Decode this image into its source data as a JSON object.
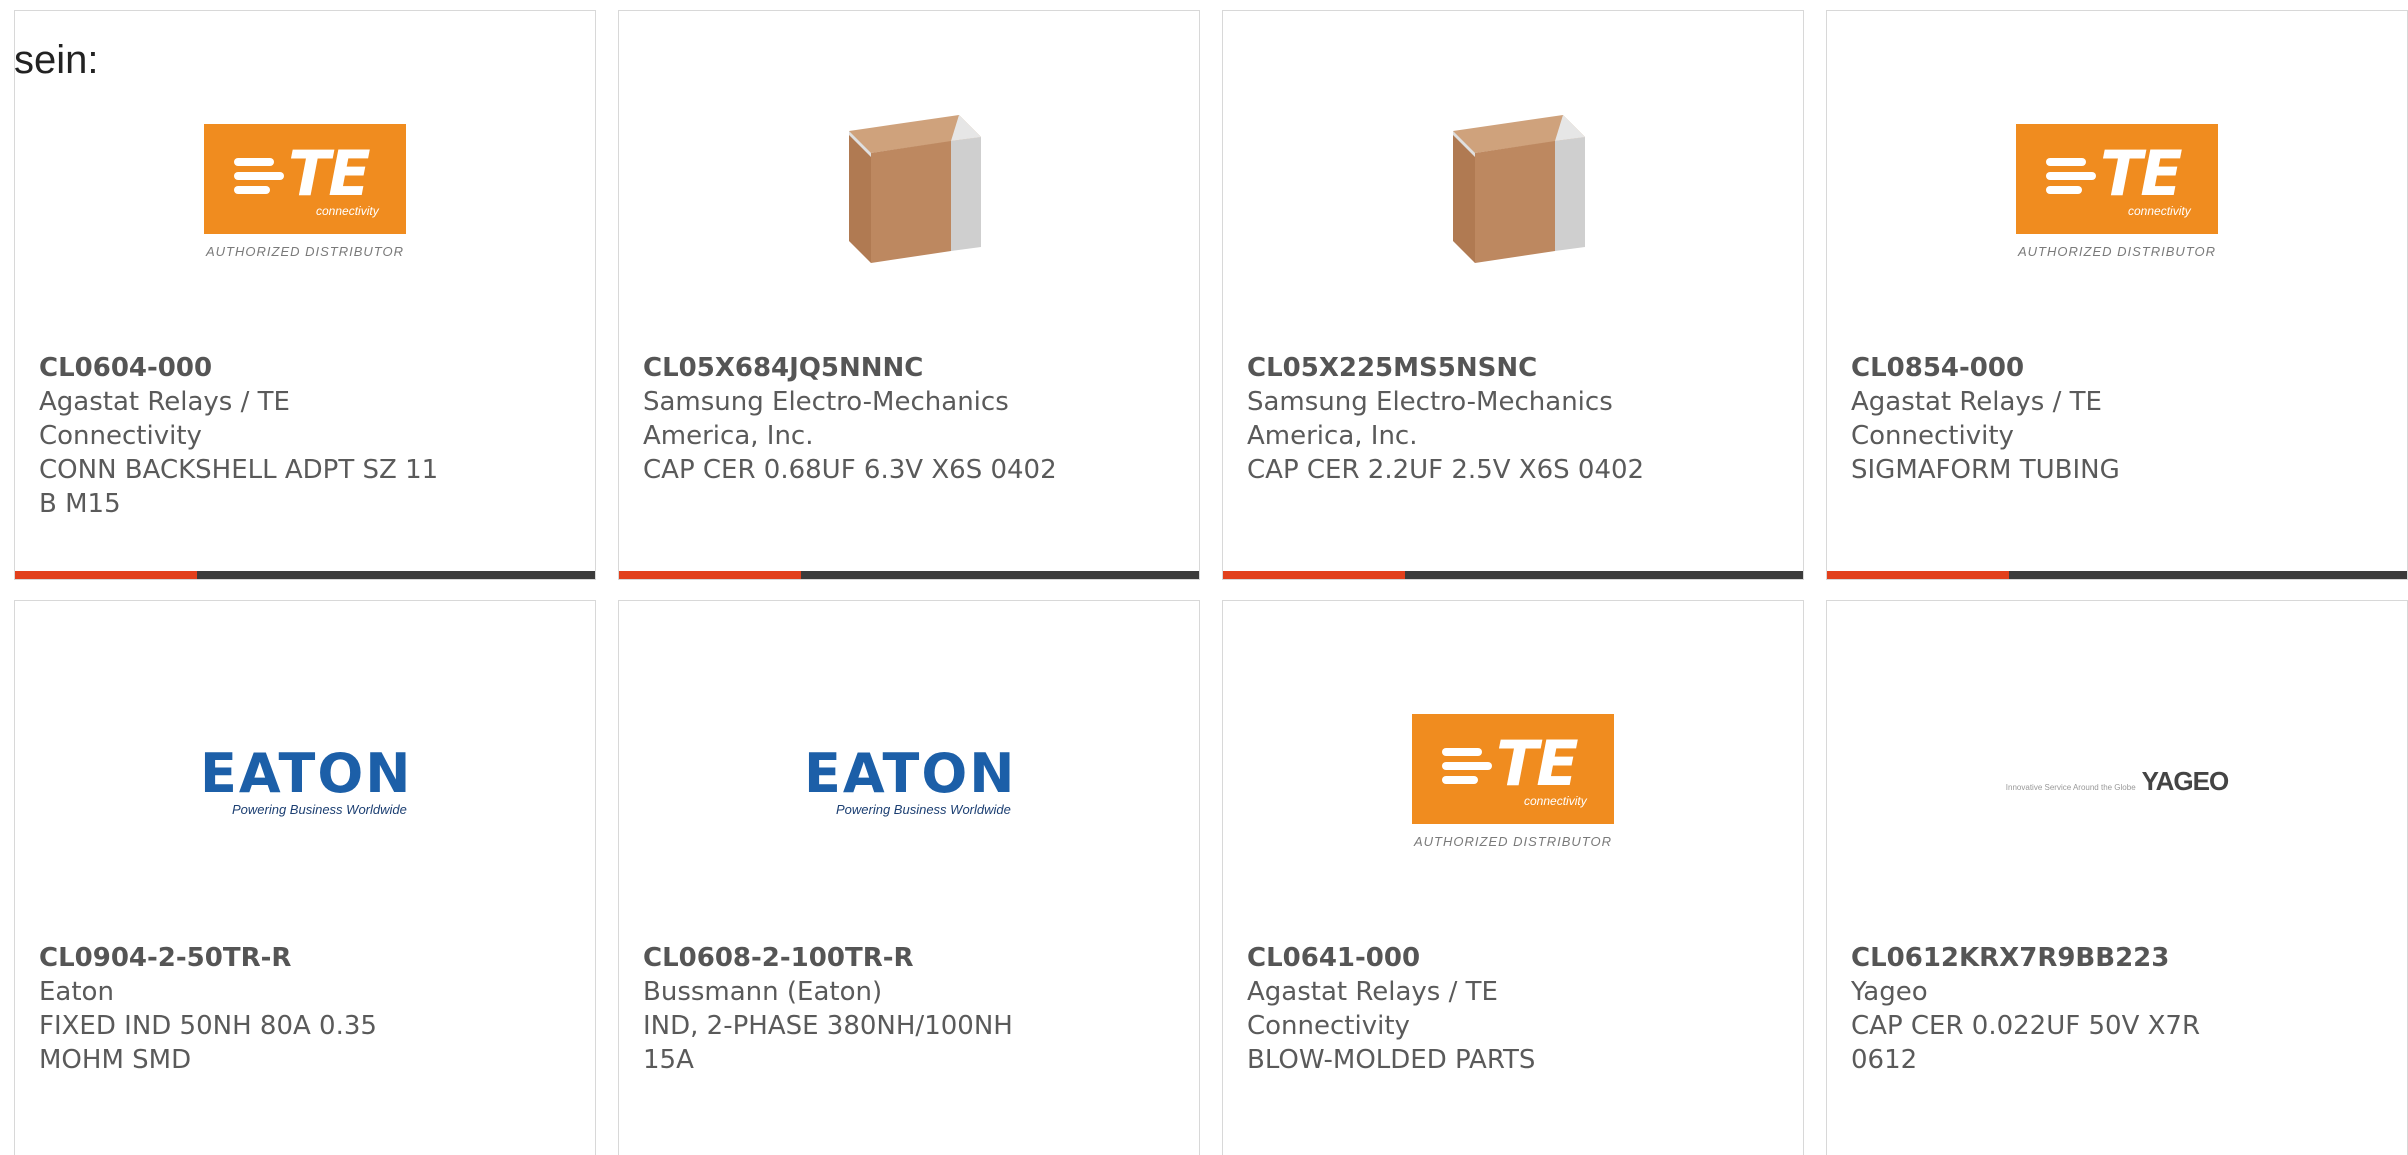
{
  "lead_text": "sein:",
  "accent_colors": {
    "bar_accent": "#e2401c",
    "bar_base": "#3b3b3b",
    "te_orange": "#f08c1f",
    "eaton_blue": "#1c5fa8"
  },
  "logos": {
    "te": {
      "letters": "TE",
      "sub": "connectivity",
      "tag": "AUTHORIZED DISTRIBUTOR"
    },
    "eaton": {
      "word": "EATON",
      "tag": "Powering Business Worldwide"
    },
    "yageo": {
      "small": "Innovative Service Around the Globe",
      "word": "YAGEO"
    }
  },
  "products": [
    {
      "image": "te-logo",
      "part": "CL0604-000",
      "manufacturer": "Agastat Relays / TE Connectivity",
      "description": "CONN BACKSHELL ADPT SZ 11 B M15"
    },
    {
      "image": "capacitor-chip",
      "part": "CL05X684JQ5NNNC",
      "manufacturer": "Samsung Electro-Mechanics America, Inc.",
      "description": "CAP CER 0.68UF 6.3V X6S 0402"
    },
    {
      "image": "capacitor-chip",
      "part": "CL05X225MS5NSNC",
      "manufacturer": "Samsung Electro-Mechanics America, Inc.",
      "description": "CAP CER 2.2UF 2.5V X6S 0402"
    },
    {
      "image": "te-logo",
      "part": "CL0854-000",
      "manufacturer": "Agastat Relays / TE Connectivity",
      "description": "SIGMAFORM TUBING"
    },
    {
      "image": "eaton-logo",
      "part": "CL0904-2-50TR-R",
      "manufacturer": "Eaton",
      "description": "FIXED IND 50NH 80A 0.35 MOHM SMD"
    },
    {
      "image": "eaton-logo",
      "part": "CL0608-2-100TR-R",
      "manufacturer": "Bussmann (Eaton)",
      "description": "IND, 2-PHASE 380NH/100NH 15A"
    },
    {
      "image": "te-logo",
      "part": "CL0641-000",
      "manufacturer": "Agastat Relays / TE Connectivity",
      "description": "BLOW-MOLDED PARTS"
    },
    {
      "image": "yageo-logo",
      "part": "CL0612KRX7R9BB223",
      "manufacturer": "Yageo",
      "description": "CAP CER 0.022UF 50V X7R 0612"
    }
  ]
}
